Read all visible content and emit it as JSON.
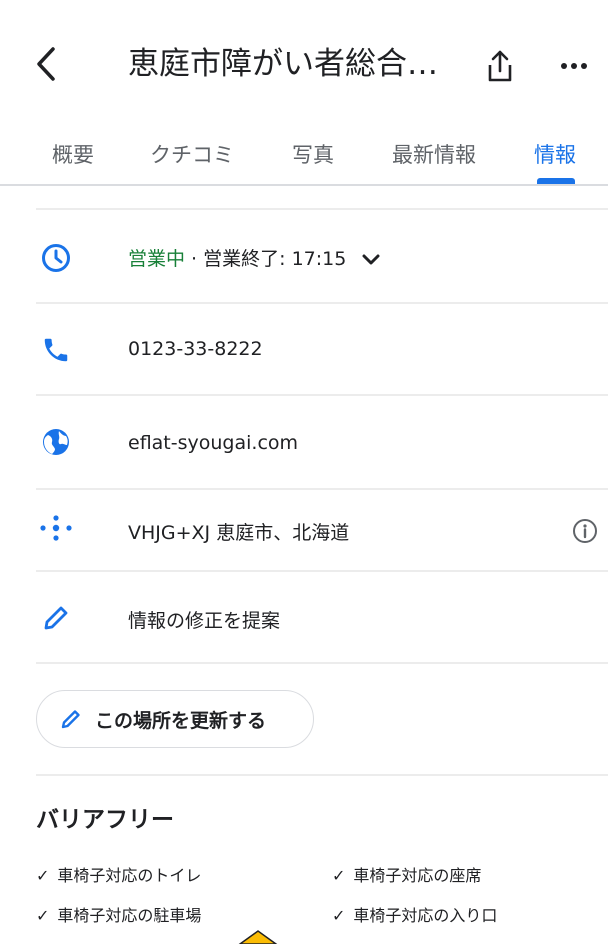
{
  "header": {
    "title": "恵庭市障がい者総合…",
    "icons": [
      "chevron-left-icon",
      "share-icon",
      "more-horizontal-icon"
    ]
  },
  "tabs": [
    {
      "label": "概要",
      "active": false
    },
    {
      "label": "クチコミ",
      "active": false
    },
    {
      "label": "写真",
      "active": false
    },
    {
      "label": "最新情報",
      "active": false
    },
    {
      "label": "情報",
      "active": true
    }
  ],
  "hours": {
    "status": "営業中",
    "separator": " · ",
    "closing": "営業終了: 17:15"
  },
  "phone": "0123-33-8222",
  "website": "eflat-syougai.com",
  "plus_code": "VHJG+XJ 恵庭市、北海道",
  "suggest_edit": "情報の修正を提案",
  "update_button": "この場所を更新する",
  "accessibility": {
    "title": "バリアフリー",
    "features": [
      "車椅子対応のトイレ",
      "車椅子対応の座席",
      "車椅子対応の駐車場",
      "車椅子対応の入り口"
    ]
  },
  "colors": {
    "accent": "#1a73e8",
    "open": "#188038",
    "text": "#202124",
    "muted": "#5f6368"
  }
}
